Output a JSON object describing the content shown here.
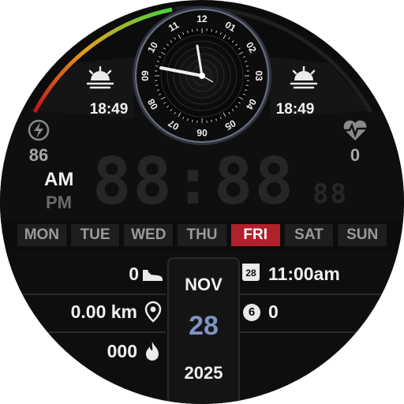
{
  "analog_clock": {
    "numbers": [
      "12",
      "01",
      "02",
      "03",
      "04",
      "05",
      "06",
      "07",
      "08",
      "09",
      "10",
      "11"
    ]
  },
  "left_widget": {
    "icon": "sunrise-icon",
    "time": "18:49"
  },
  "right_widget": {
    "icon": "sunset-icon",
    "time": "18:49"
  },
  "battery": {
    "icon": "lightning-icon",
    "value": "86"
  },
  "heart_rate": {
    "icon": "heart-pulse-icon",
    "value": "0"
  },
  "digital_time": {
    "am": "AM",
    "pm": "PM",
    "hours_minutes": "88:88",
    "seconds": "88"
  },
  "weekdays": [
    "MON",
    "TUE",
    "WED",
    "THU",
    "FRI",
    "SAT",
    "SUN"
  ],
  "active_day_index": 4,
  "steps": {
    "value": "0",
    "icon": "sneaker-icon"
  },
  "distance": {
    "value": "0.00 km",
    "icon": "location-pin-icon"
  },
  "calories": {
    "value": "000",
    "icon": "flame-icon"
  },
  "event": {
    "icon": "calendar-icon",
    "calendar_day": "28",
    "time": "11:00am"
  },
  "notifications": {
    "icon": "notification-badge-icon",
    "badge": "6",
    "count": "0"
  },
  "date": {
    "month": "NOV",
    "day": "28",
    "year": "2025"
  },
  "colors": {
    "accent_red": "#b0212b",
    "gauge_start": "#c0121a",
    "gauge_mid": "#e8a020",
    "gauge_end": "#43d43a",
    "date_day": "#7f93c6"
  }
}
